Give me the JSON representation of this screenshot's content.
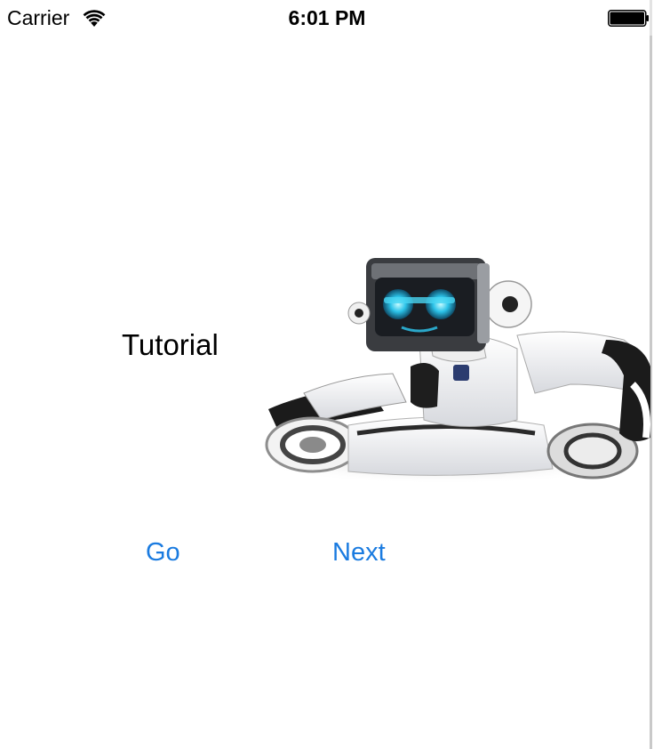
{
  "status_bar": {
    "carrier": "Carrier",
    "time": "6:01 PM",
    "wifi_icon": "wifi-icon",
    "battery_icon": "battery-icon"
  },
  "main": {
    "title": "Tutorial",
    "image_icon": "robot-image",
    "buttons": [
      {
        "label": "Go"
      },
      {
        "label": "Next"
      }
    ]
  },
  "colors": {
    "accent": "#1a7be0",
    "text": "#000000",
    "background": "#ffffff"
  }
}
